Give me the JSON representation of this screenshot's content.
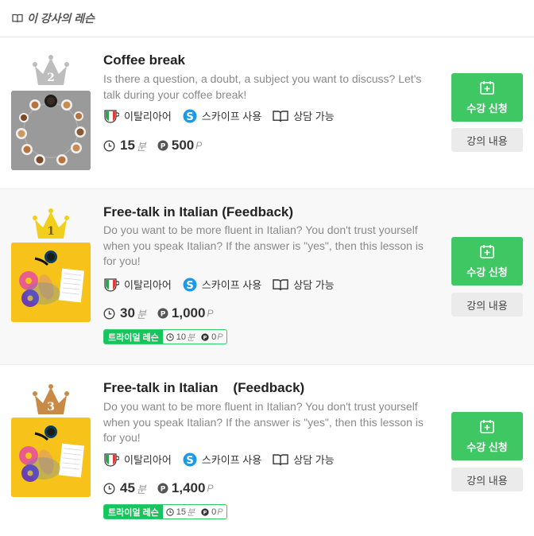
{
  "header": {
    "title": "이 강사의 레슨"
  },
  "lessons": [
    {
      "rank": "2",
      "title": "Coffee break",
      "description": "Is there a question, a doubt, a subject you want to discuss? Let's talk during your coffee break!",
      "tags": {
        "language": "이탈리아어",
        "skype": "스카이프 사용",
        "consult": "상담 가능"
      },
      "duration": "15",
      "duration_unit": "분",
      "price": "500",
      "price_unit": "P",
      "enroll_label": "수강 신청",
      "content_label": "강의 내용",
      "crown_color": "#bdbdbd"
    },
    {
      "rank": "1",
      "title": "Free-talk in Italian (Feedback)",
      "description": "Do you want to be more fluent in Italian? You don't trust yourself when you speak Italian? If the answer is \"yes\", then this lesson is for you!",
      "tags": {
        "language": "이탈리아어",
        "skype": "스카이프 사용",
        "consult": "상담 가능"
      },
      "duration": "30",
      "duration_unit": "분",
      "price": "1,000",
      "price_unit": "P",
      "trial": {
        "label": "트라이얼 레슨",
        "duration": "10",
        "duration_unit": "분",
        "price": "0",
        "price_unit": "P"
      },
      "enroll_label": "수강 신청",
      "content_label": "강의 내용",
      "crown_color": "#f2cf1d"
    },
    {
      "rank": "3",
      "title": "Free-talk in Italian    (Feedback)",
      "description": "Do you want to be more fluent in Italian? You don't trust yourself when you speak Italian? If the answer is \"yes\", then this lesson is for you!",
      "tags": {
        "language": "이탈리아어",
        "skype": "스카이프 사용",
        "consult": "상담 가능"
      },
      "duration": "45",
      "duration_unit": "분",
      "price": "1,400",
      "price_unit": "P",
      "trial": {
        "label": "트라이얼 레슨",
        "duration": "15",
        "duration_unit": "분",
        "price": "0",
        "price_unit": "P"
      },
      "enroll_label": "수강 신청",
      "content_label": "강의 내용",
      "crown_color": "#c98a45"
    }
  ]
}
